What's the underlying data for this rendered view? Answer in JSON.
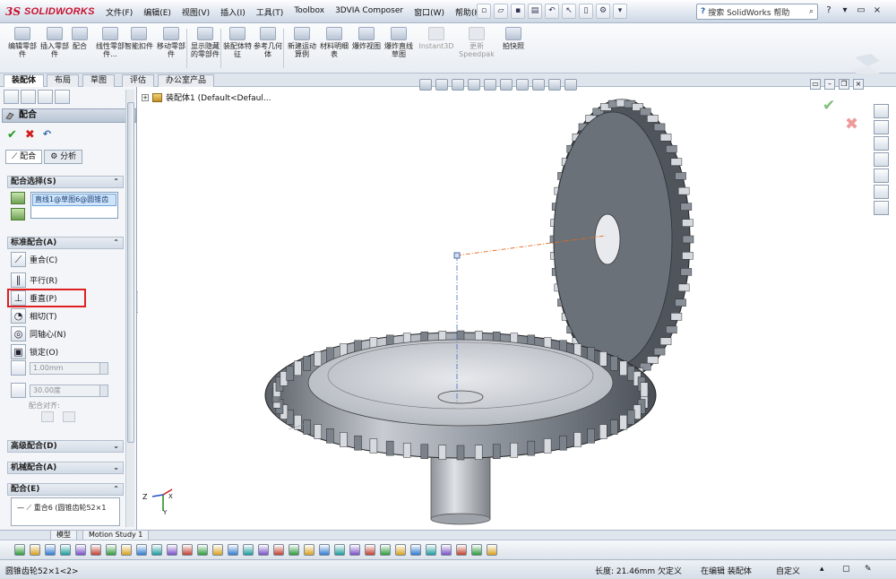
{
  "app": {
    "logo_prefix": "3S",
    "logo_name": "SOLIDWORKS"
  },
  "menu": {
    "items": [
      "文件(F)",
      "编辑(E)",
      "视图(V)",
      "插入(I)",
      "工具(T)",
      "Toolbox",
      "3DVIA Composer",
      "窗口(W)",
      "帮助(H)"
    ],
    "search_placeholder": "搜索 SolidWorks 帮助"
  },
  "commands": [
    {
      "label": "编辑零部件",
      "enabled": true
    },
    {
      "label": "插入零部件",
      "enabled": true
    },
    {
      "label": "配合",
      "enabled": true
    },
    {
      "label": "线性零部件...",
      "enabled": true
    },
    {
      "label": "智能扣件",
      "enabled": true
    },
    {
      "label": "移动零部件",
      "enabled": true
    },
    {
      "label": "显示隐藏的零部件",
      "enabled": true
    },
    {
      "label": "装配体特征",
      "enabled": true
    },
    {
      "label": "参考几何体",
      "enabled": true
    },
    {
      "label": "新建运动算例",
      "enabled": true
    },
    {
      "label": "材料明细表",
      "enabled": true
    },
    {
      "label": "爆炸视图",
      "enabled": true
    },
    {
      "label": "爆炸直线草图",
      "enabled": true
    },
    {
      "label": "Instant3D",
      "enabled": false
    },
    {
      "label": "更新Speedpak",
      "enabled": false
    },
    {
      "label": "拍快照",
      "enabled": true
    }
  ],
  "tabs": [
    "装配体",
    "布局",
    "草图",
    "评估",
    "办公室产品"
  ],
  "active_tab": "装配体",
  "property_manager": {
    "title": "配合",
    "help": "?",
    "subtabs": [
      "配合",
      "分析"
    ],
    "selections_header": "配合选择(S)",
    "selection_item": "直线1@草图6@圆锥齿",
    "standard_header": "标准配合(A)",
    "mates": [
      {
        "label": "重合(C)",
        "icon": "coincident-icon"
      },
      {
        "label": "平行(R)",
        "icon": "parallel-icon"
      },
      {
        "label": "垂直(P)",
        "icon": "perpendicular-icon"
      },
      {
        "label": "相切(T)",
        "icon": "tangent-icon"
      },
      {
        "label": "同轴心(N)",
        "icon": "concentric-icon"
      },
      {
        "label": "锁定(O)",
        "icon": "lock-icon"
      }
    ],
    "distance_value": "1.00mm",
    "angle_value": "30.00度",
    "alignment_label": "配合对齐:",
    "advanced_header": "高级配合(D)",
    "mechanical_header": "机械配合(A)",
    "mates_header": "配合(E)",
    "mate_entry": "重合6 (圆锥齿轮52×1"
  },
  "graphics": {
    "tree_item": "装配体1  (Default<Defaul...",
    "triad_axes": [
      "Z",
      "X",
      "Y"
    ]
  },
  "bottom": {
    "motion_tabs": [
      "模型",
      "Motion Study 1"
    ]
  },
  "status": {
    "selection": "圆锥齿轮52×1<2>",
    "length": "长度: 21.46mm",
    "defined": "欠定义",
    "mode": "在编辑 装配体",
    "custom": "自定义"
  }
}
